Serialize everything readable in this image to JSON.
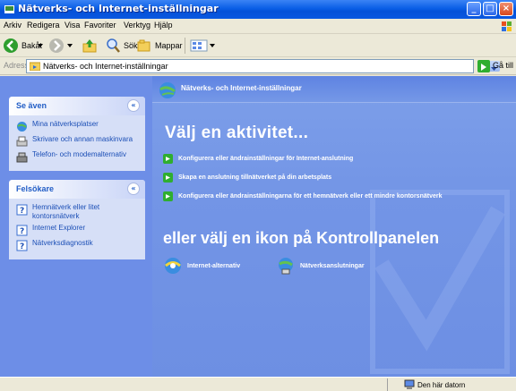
{
  "window": {
    "title": "Nätverks- och Internet-inställningar"
  },
  "menubar": {
    "items": [
      {
        "label": "Arkiv"
      },
      {
        "label": "Redigera"
      },
      {
        "label": "Visa"
      },
      {
        "label": "Favoriter"
      },
      {
        "label": "Verktyg"
      },
      {
        "label": "Hjälp"
      }
    ]
  },
  "toolbar": {
    "back_label": "Bakåt",
    "search_label": "Sök",
    "folders_label": "Mappar"
  },
  "addressbar": {
    "label": "Adress",
    "value": "Nätverks- och Internet-inställningar",
    "go_label": "Gå till"
  },
  "sidebar": {
    "see_also": {
      "title": "Se även",
      "collapse_glyph": "«",
      "links": [
        {
          "label": "Mina nätverksplatser",
          "icon": "network-places-icon"
        },
        {
          "label": "Skrivare och annan maskinvara",
          "icon": "printer-icon"
        },
        {
          "label": "Telefon- och modemalternativ",
          "icon": "phone-modem-icon"
        }
      ]
    },
    "troubleshoot": {
      "title": "Felsökare",
      "collapse_glyph": "«",
      "links": [
        {
          "label": "Hemnätverk eller litet kontorsnätverk",
          "icon": "help-icon"
        },
        {
          "label": "Internet Explorer",
          "icon": "help-icon"
        },
        {
          "label": "Nätverksdiagnostik",
          "icon": "help-icon"
        }
      ]
    }
  },
  "main": {
    "header_title": "Nätverks- och Internet-inställningar",
    "pick_task": "Välj en aktivitet...",
    "tasks": [
      {
        "label": "Konfigurera eller ändrainställningar för Internet-anslutning"
      },
      {
        "label": "Skapa en anslutning tillnätverket på din arbetsplats"
      },
      {
        "label": "Konfigurera eller ändrainställningarna för ett hemnätverk eller ett mindre kontorsnätverk"
      }
    ],
    "pick_icon": "eller välj en ikon på Kontrollpanelen",
    "cp_items": [
      {
        "label": "Internet-alternativ",
        "icon": "internet-options-icon"
      },
      {
        "label": "Nätverksanslutningar",
        "icon": "network-connections-icon"
      }
    ]
  },
  "statusbar": {
    "zone": "Den här datorn"
  },
  "colors": {
    "titlebar": "#0a5fe6",
    "sidebar_bg": "#6d8ee7",
    "main_bg": "#7395e6",
    "link": "#1c4fb6",
    "go_green": "#2fae2f"
  }
}
